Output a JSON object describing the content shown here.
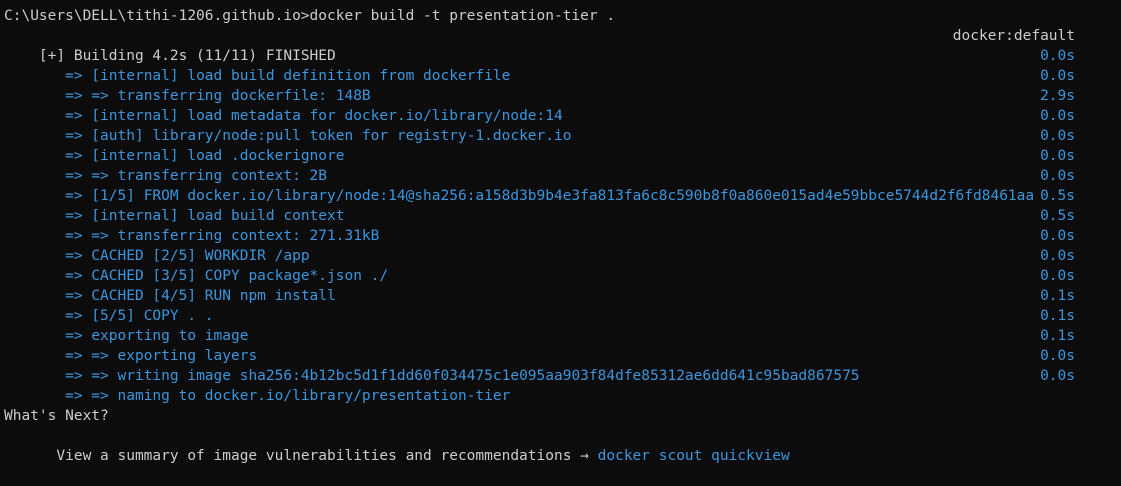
{
  "prompt_line": "C:\\Users\\DELL\\tithi-1206.github.io>docker build -t presentation-tier .",
  "header": {
    "status": "[+] Building 4.2s (11/11) FINISHED",
    "builder": "docker:default"
  },
  "steps": [
    {
      "text": " => [internal] load build definition from dockerfile",
      "time": "0.0s"
    },
    {
      "text": " => => transferring dockerfile: 148B",
      "time": "0.0s"
    },
    {
      "text": " => [internal] load metadata for docker.io/library/node:14",
      "time": "2.9s"
    },
    {
      "text": " => [auth] library/node:pull token for registry-1.docker.io",
      "time": "0.0s"
    },
    {
      "text": " => [internal] load .dockerignore",
      "time": "0.0s"
    },
    {
      "text": " => => transferring context: 2B",
      "time": "0.0s"
    },
    {
      "text": " => [1/5] FROM docker.io/library/node:14@sha256:a158d3b9b4e3fa813fa6c8c590b8f0a860e015ad4e59bbce5744d2f6fd8461aa",
      "time": "0.0s"
    },
    {
      "text": " => [internal] load build context",
      "time": "0.5s"
    },
    {
      "text": " => => transferring context: 271.31kB",
      "time": "0.5s"
    },
    {
      "text": " => CACHED [2/5] WORKDIR /app",
      "time": "0.0s"
    },
    {
      "text": " => CACHED [3/5] COPY package*.json ./",
      "time": "0.0s"
    },
    {
      "text": " => CACHED [4/5] RUN npm install",
      "time": "0.0s"
    },
    {
      "text": " => [5/5] COPY . .",
      "time": "0.1s"
    },
    {
      "text": " => exporting to image",
      "time": "0.1s"
    },
    {
      "text": " => => exporting layers",
      "time": "0.1s"
    },
    {
      "text": " => => writing image sha256:4b12bc5d1f1dd60f034475c1e095aa903f84dfe85312ae6dd641c95bad867575",
      "time": "0.0s"
    },
    {
      "text": " => => naming to docker.io/library/presentation-tier",
      "time": "0.0s"
    }
  ],
  "next": {
    "heading": "What's Next?",
    "description": "  View a summary of image vulnerabilities and recommendations → ",
    "command": "docker scout quickview"
  },
  "colors": {
    "background": "#0c0c0c",
    "text": "#cccccc",
    "accent": "#3a96dd"
  }
}
